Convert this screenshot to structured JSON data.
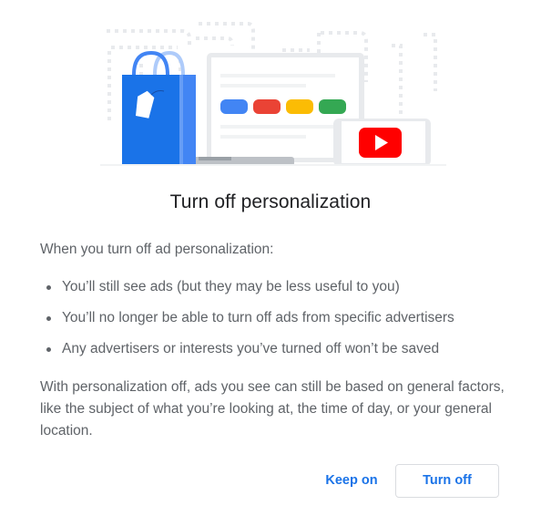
{
  "illustration": {
    "description": "shopping bag, laptop with colored buttons, phone with video play",
    "button_colors": [
      "#4285f4",
      "#ea4335",
      "#fbbc04",
      "#34a853"
    ],
    "bag_color": "#1a73e8",
    "play_color": "#ff0000"
  },
  "dialog": {
    "title": "Turn off personalization",
    "intro": "When you turn off ad personalization:",
    "bullets": [
      "You’ll still see ads (but they may be less useful to you)",
      "You’ll no longer be able to turn off ads from specific advertisers",
      "Any advertisers or interests you’ve turned off won’t be saved"
    ],
    "note": "With personalization off, ads you see can still be based on general factors, like the subject of what you’re looking at, the time of day, or your general location.",
    "actions": {
      "keep_on": "Keep on",
      "turn_off": "Turn off"
    }
  }
}
